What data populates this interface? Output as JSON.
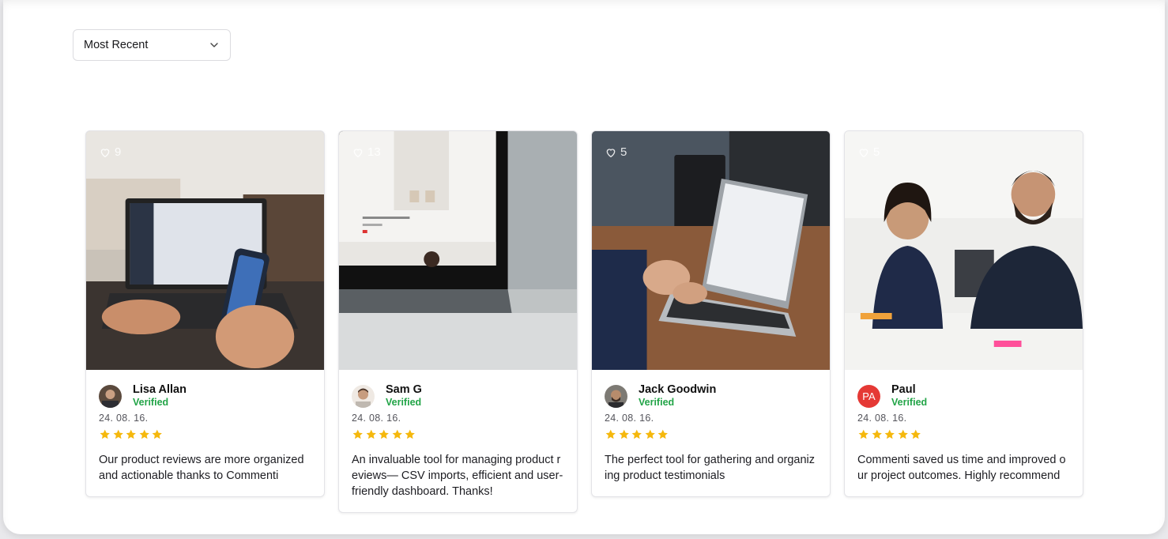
{
  "sort": {
    "selected": "Most Recent",
    "icon": "chevron-down-icon"
  },
  "colors": {
    "verified": "#22a447",
    "star": "#f5b80d",
    "avatar_paul": "#e53935"
  },
  "reviews": [
    {
      "likes": "9",
      "name": "Lisa Allan",
      "badge": "Verified",
      "date": "24. 08. 16.",
      "rating": 5,
      "text": "Our product reviews are more organized and actionable thanks to Commenti"
    },
    {
      "likes": "13",
      "name": "Sam G",
      "badge": "Verified",
      "date": "24. 08. 16.",
      "rating": 5,
      "text": "An invaluable tool for managing product reviews— CSV imports, efficient and user-friendly dashboard. Thanks!"
    },
    {
      "likes": "5",
      "name": "Jack Goodwin",
      "badge": "Verified",
      "date": "24. 08. 16.",
      "rating": 5,
      "text": "The perfect tool for gathering and organizing product testimonials"
    },
    {
      "likes": "5",
      "name": "Paul",
      "badge": "Verified",
      "date": "24. 08. 16.",
      "rating": 5,
      "initials": "PA",
      "text": "Commenti saved us time and improved our project outcomes. Highly recommend"
    }
  ]
}
